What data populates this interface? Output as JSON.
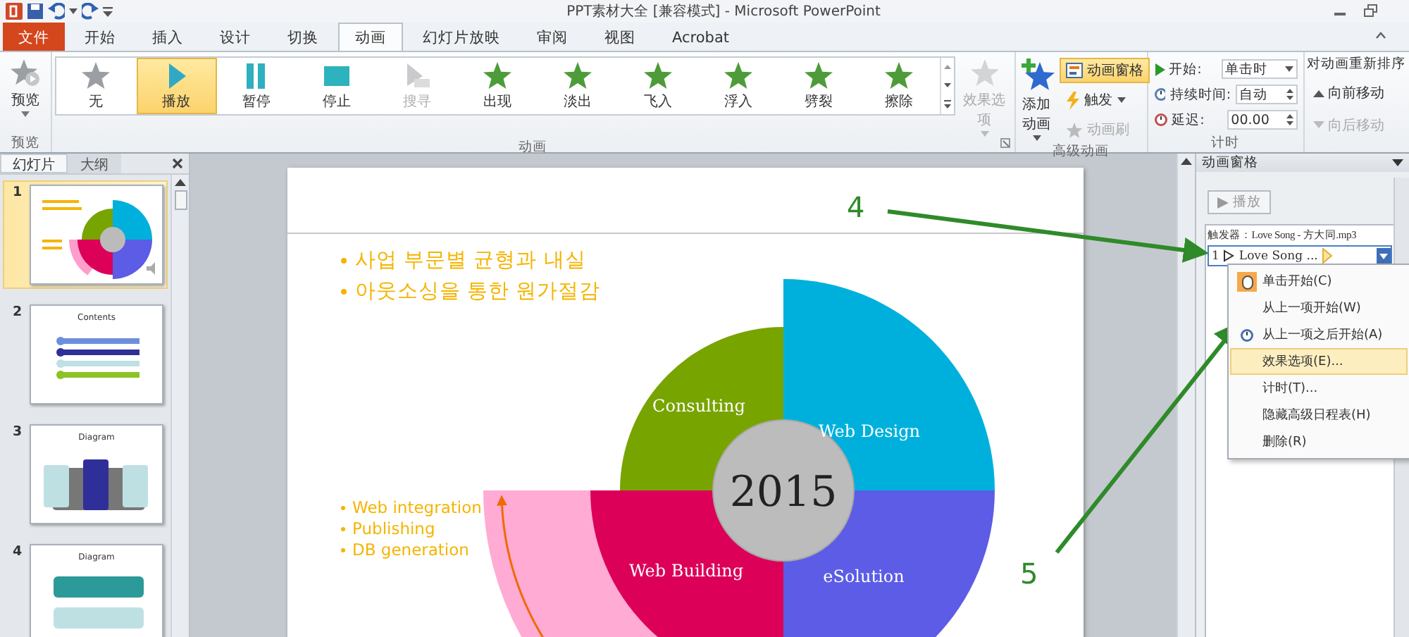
{
  "window": {
    "title": "PPT素材大全 [兼容模式] - Microsoft PowerPoint"
  },
  "tabs": [
    {
      "label": "文件",
      "kind": "file",
      "selected": false
    },
    {
      "label": "开始",
      "kind": "tab",
      "selected": false
    },
    {
      "label": "插入",
      "kind": "tab",
      "selected": false
    },
    {
      "label": "设计",
      "kind": "tab",
      "selected": false
    },
    {
      "label": "切换",
      "kind": "tab",
      "selected": false
    },
    {
      "label": "动画",
      "kind": "tab",
      "selected": true
    },
    {
      "label": "幻灯片放映",
      "kind": "tab",
      "selected": false
    },
    {
      "label": "审阅",
      "kind": "tab",
      "selected": false
    },
    {
      "label": "视图",
      "kind": "tab",
      "selected": false
    },
    {
      "label": "Acrobat",
      "kind": "tab",
      "selected": false
    }
  ],
  "ribbon": {
    "preview": {
      "label": "预览",
      "group": "预览"
    },
    "animation_group": "动画",
    "animations": [
      {
        "label": "无",
        "kind": "none",
        "selected": false,
        "disabled": false
      },
      {
        "label": "播放",
        "kind": "play",
        "selected": true,
        "disabled": false
      },
      {
        "label": "暂停",
        "kind": "pause",
        "selected": false,
        "disabled": false
      },
      {
        "label": "停止",
        "kind": "stop",
        "selected": false,
        "disabled": false
      },
      {
        "label": "搜寻",
        "kind": "seek",
        "selected": false,
        "disabled": true
      },
      {
        "label": "出现",
        "kind": "effect",
        "selected": false,
        "disabled": false
      },
      {
        "label": "淡出",
        "kind": "effect",
        "selected": false,
        "disabled": false
      },
      {
        "label": "飞入",
        "kind": "effect",
        "selected": false,
        "disabled": false
      },
      {
        "label": "浮入",
        "kind": "effect",
        "selected": false,
        "disabled": false
      },
      {
        "label": "劈裂",
        "kind": "effect",
        "selected": false,
        "disabled": false
      },
      {
        "label": "擦除",
        "kind": "effect",
        "selected": false,
        "disabled": false
      }
    ],
    "effect_options": {
      "label": "效果选项",
      "disabled": true
    },
    "advanced": {
      "group": "高级动画",
      "add": "添加动画",
      "buttons": [
        {
          "label": "动画窗格",
          "kind": "pane",
          "selected": true,
          "disabled": false
        },
        {
          "label": "触发",
          "kind": "trigger",
          "selected": false,
          "disabled": false
        },
        {
          "label": "动画刷",
          "kind": "painter",
          "selected": false,
          "disabled": true
        }
      ]
    },
    "timing": {
      "group": "计时",
      "rows": [
        {
          "label": "开始:",
          "value": "单击时",
          "kind": "dropdown"
        },
        {
          "label": "持续时间:",
          "value": "自动",
          "kind": "spinner"
        },
        {
          "label": "延迟:",
          "value": "00.00",
          "kind": "spinner"
        }
      ]
    },
    "reorder": {
      "title": "对动画重新排序",
      "buttons": [
        {
          "label": "向前移动",
          "disabled": false
        },
        {
          "label": "向后移动",
          "disabled": true
        }
      ]
    }
  },
  "slides_panel": {
    "tabs": [
      {
        "label": "幻灯片",
        "selected": true
      },
      {
        "label": "大纲",
        "selected": false
      }
    ],
    "slides": [
      {
        "number": "1",
        "kind": "wheel",
        "selected": true
      },
      {
        "number": "2",
        "kind": "contents",
        "title": "Contents",
        "selected": false
      },
      {
        "number": "3",
        "kind": "columns",
        "title": "Diagram",
        "selected": false
      },
      {
        "number": "4",
        "kind": "bars",
        "title": "Diagram",
        "selected": false
      }
    ]
  },
  "slide": {
    "bullets": [
      "사업 부문별 균형과 내실",
      "아웃소싱을 통한 원가절감"
    ],
    "sub_bullets": [
      "Web integration",
      "Publishing",
      "DB generation"
    ],
    "center": "2015",
    "segments": [
      {
        "label": "Consulting",
        "color": "#78a400"
      },
      {
        "label": "Web Design",
        "color": "#00b0dc"
      },
      {
        "label": "Web Building",
        "color": "#dc0058"
      },
      {
        "label": "eSolution",
        "color": "#5c5ce6"
      }
    ]
  },
  "animation_pane": {
    "title": "动画窗格",
    "play": {
      "label": "播放",
      "disabled": true
    },
    "trigger": "触发器：Love Song - 方大同.mp3",
    "items": [
      {
        "number": "1",
        "label": "Love Song ...",
        "selected": true
      }
    ],
    "menu": [
      {
        "label": "单击开始(C)",
        "kind": "mouse",
        "selected": false
      },
      {
        "label": "从上一项开始(W)",
        "kind": "plain",
        "selected": false
      },
      {
        "label": "从上一项之后开始(A)",
        "kind": "clock",
        "selected": false
      },
      {
        "label": "效果选项(E)...",
        "kind": "plain",
        "selected": true
      },
      {
        "label": "计时(T)...",
        "kind": "plain",
        "selected": false
      },
      {
        "label": "隐藏高级日程表(H)",
        "kind": "plain",
        "selected": false
      },
      {
        "label": "删除(R)",
        "kind": "plain",
        "selected": false
      }
    ]
  },
  "annotations": [
    {
      "label": "4"
    },
    {
      "label": "5"
    }
  ]
}
